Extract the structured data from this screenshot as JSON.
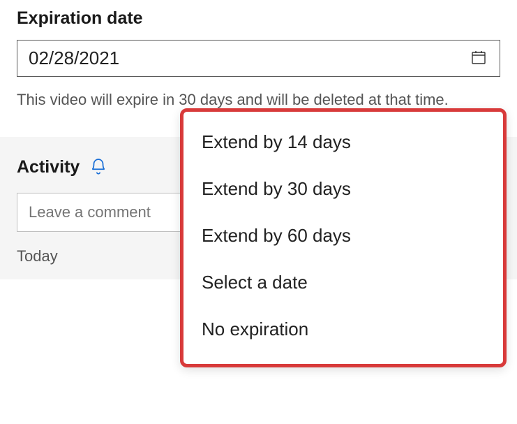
{
  "field": {
    "label": "Expiration date",
    "value": "02/28/2021",
    "helper_text": "This video will expire in 30 days and will be deleted at that time."
  },
  "menu": {
    "options": [
      "Extend by 14 days",
      "Extend by 30 days",
      "Extend by 60 days",
      "Select a date",
      "No expiration"
    ]
  },
  "activity": {
    "title": "Activity",
    "comment_placeholder": "Leave a comment",
    "today_label": "Today"
  },
  "icons": {
    "calendar": "calendar-icon",
    "bell": "bell-icon",
    "chevron_down": "chevron-down-icon"
  }
}
